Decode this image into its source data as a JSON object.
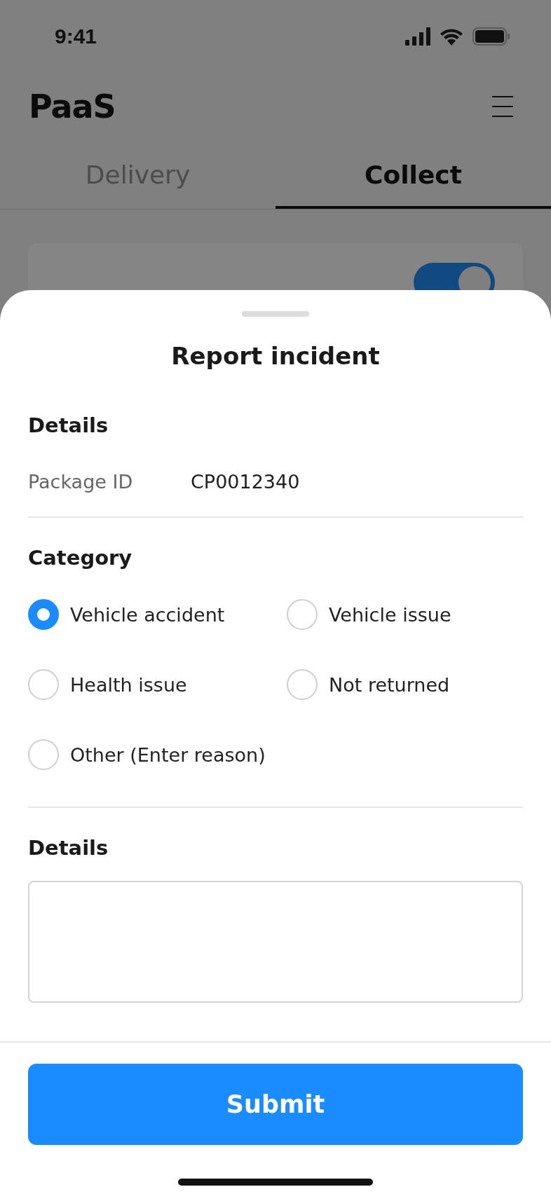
{
  "status_bar": {
    "time": "9:41"
  },
  "header": {
    "logo": "PaaS"
  },
  "tabs": [
    {
      "label": "Delivery",
      "selected": false
    },
    {
      "label": "Collect",
      "selected": true
    }
  ],
  "card": {
    "toggle": {
      "on": true
    }
  },
  "sheet": {
    "title": "Report incident",
    "details": {
      "heading": "Details",
      "rows": [
        {
          "label": "Package ID",
          "value": "CP0012340"
        }
      ]
    },
    "category": {
      "heading": "Category",
      "options": [
        {
          "label": "Vehicle accident",
          "selected": true
        },
        {
          "label": "Vehicle issue",
          "selected": false
        },
        {
          "label": "Health issue",
          "selected": false
        },
        {
          "label": "Not returned",
          "selected": false
        },
        {
          "label": "Other (Enter reason)",
          "selected": false
        }
      ]
    },
    "notes": {
      "heading": "Details"
    },
    "submit": "Submit"
  }
}
